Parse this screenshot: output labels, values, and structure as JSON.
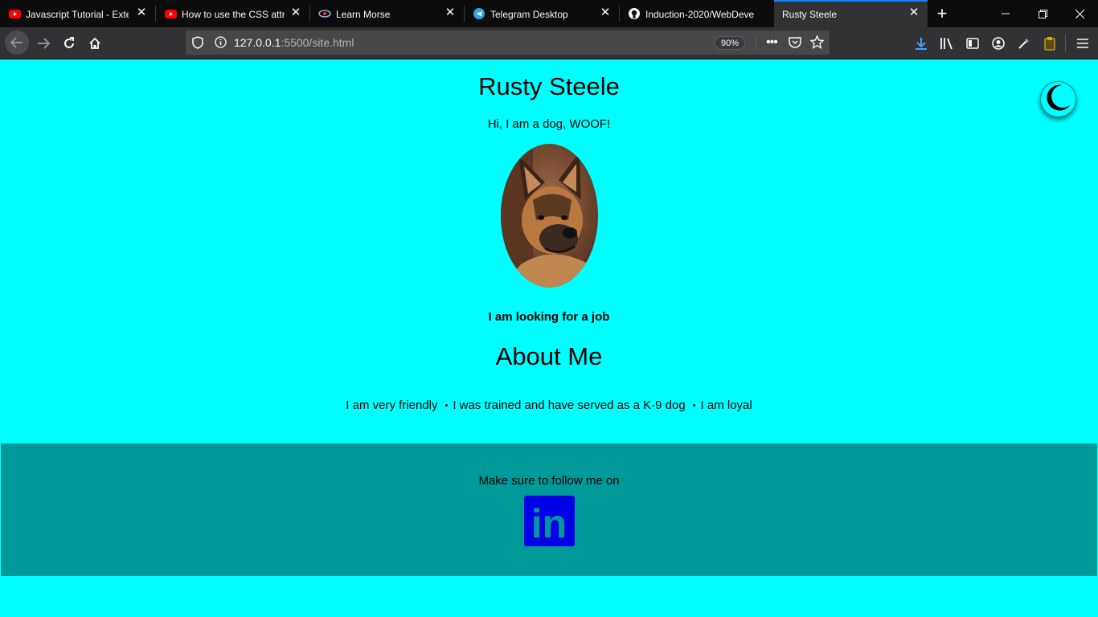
{
  "browser": {
    "tabs": [
      {
        "title": "Javascript Tutorial - Exter",
        "icon": "youtube-icon"
      },
      {
        "title": "How to use the CSS attr()",
        "icon": "youtube-icon"
      },
      {
        "title": "Learn Morse",
        "icon": "morse-icon"
      },
      {
        "title": "Telegram Desktop",
        "icon": "telegram-icon"
      },
      {
        "title": "Induction-2020/WebDeve",
        "icon": "github-icon"
      },
      {
        "title": "Rusty Steele",
        "icon": "none"
      }
    ],
    "url_host": "127.0.0.1",
    "url_rest": ":5500/site.html",
    "zoom": "90%"
  },
  "page": {
    "title": "Rusty Steele",
    "greeting": "Hi, I am a dog, WOOF!",
    "job_status": "I am looking for a job",
    "about_heading": "About Me",
    "traits": [
      "I am very friendly",
      "I was trained and have served as a K-9 dog",
      "I am loyal"
    ],
    "bullet": "•"
  },
  "footer": {
    "follow_text": "Make sure to follow me on",
    "linkedin_text": "in"
  },
  "colors": {
    "page_bg": "#00ffff",
    "footer_bg": "#009999",
    "linkedin": "#0000e6"
  }
}
